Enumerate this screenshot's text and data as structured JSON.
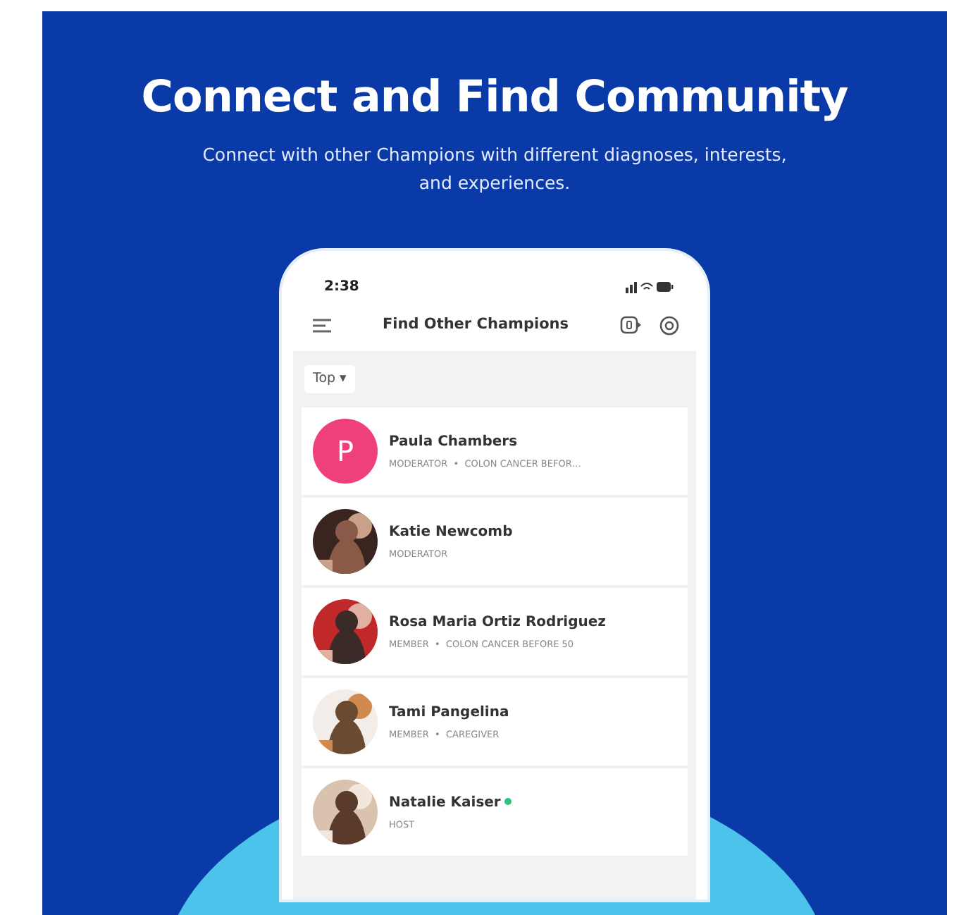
{
  "headline": "Connect and Find Community",
  "subheadline": "Connect with other Champions with different diagnoses, interests, and experiences.",
  "phone": {
    "status_time": "2:38",
    "title": "Find Other Champions",
    "filter": "Top ▾",
    "members": [
      {
        "name": "Paula Chambers",
        "subtitle": "MODERATOR  •  COLON CANCER BEFOR…",
        "avatar": {
          "kind": "initial",
          "letter": "P",
          "color": "#f0407a"
        },
        "online": false
      },
      {
        "name": "Katie Newcomb",
        "subtitle": "MODERATOR",
        "online": false
      },
      {
        "name": "Rosa Maria Ortiz Rodriguez",
        "subtitle": "MEMBER  •  COLON CANCER BEFORE 50",
        "online": false
      },
      {
        "name": "Tami Pangelina",
        "subtitle": "MEMBER  •  CAREGIVER",
        "online": false
      },
      {
        "name": "Natalie Kaiser",
        "subtitle": "HOST",
        "online": true
      }
    ]
  }
}
